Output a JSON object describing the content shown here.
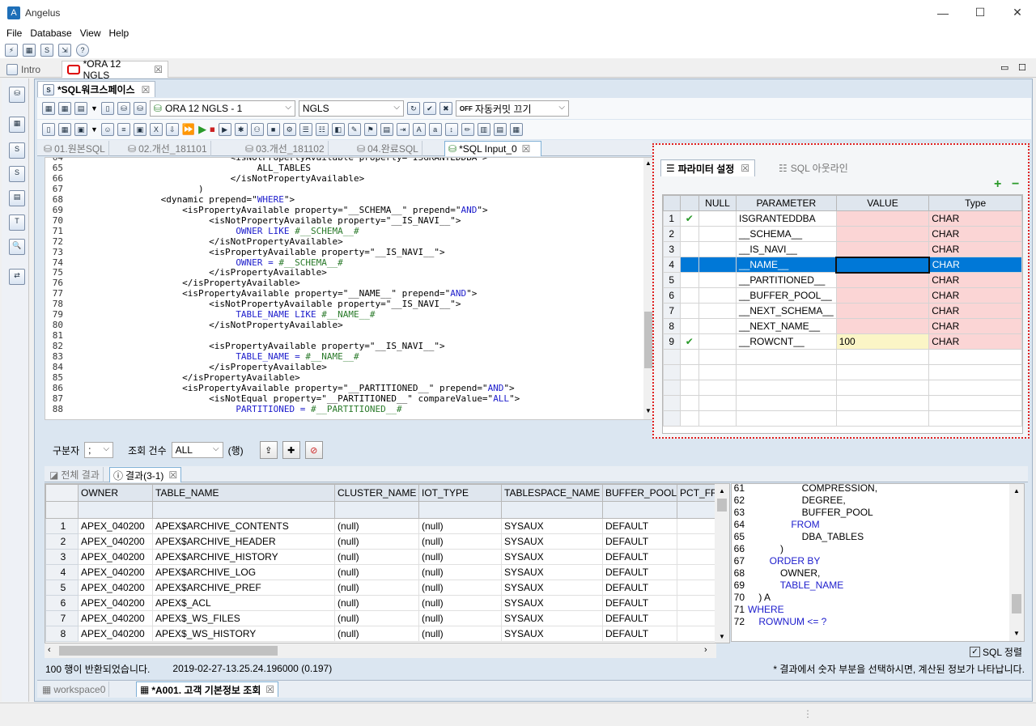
{
  "window": {
    "title": "Angelus",
    "min": "—",
    "max": "☐",
    "close": "✕"
  },
  "menu": [
    "File",
    "Database",
    "View",
    "Help"
  ],
  "top_tabs": [
    {
      "label": "Intro"
    },
    {
      "label": "*ORA 12 NGLS",
      "close": "☒"
    }
  ],
  "workspace_tab": {
    "label": "*SQL워크스페이스",
    "close": "☒"
  },
  "toolbar": {
    "connection": "ORA 12 NGLS - 1",
    "schema": "NGLS",
    "autocommit": "자동커밋 끄기"
  },
  "sql_tabs": [
    "01.원본SQL",
    "02.개선_181101",
    "03.개선_181102",
    "04.완료SQL",
    "*SQL Input_0"
  ],
  "code_lines": [
    {
      "n": "64",
      "t": "                              <isNotPropertyAvailable property=\"ISGRANTEDDBA\">"
    },
    {
      "n": "65",
      "t": "                                   ALL_TABLES"
    },
    {
      "n": "66",
      "t": "                              </isNotPropertyAvailable>"
    },
    {
      "n": "67",
      "t": "                        )"
    },
    {
      "n": "68",
      "t": "                 <dynamic prepend=\"WHERE\">"
    },
    {
      "n": "69",
      "t": "                     <isPropertyAvailable property=\"__SCHEMA__\" prepend=\"AND\">"
    },
    {
      "n": "70",
      "t": "                          <isNotPropertyAvailable property=\"__IS_NAVI__\">"
    },
    {
      "n": "71",
      "t": "                               OWNER LIKE #__SCHEMA__#"
    },
    {
      "n": "72",
      "t": "                          </isNotPropertyAvailable>"
    },
    {
      "n": "73",
      "t": "                          <isPropertyAvailable property=\"__IS_NAVI__\">"
    },
    {
      "n": "74",
      "t": "                               OWNER = #__SCHEMA__#"
    },
    {
      "n": "75",
      "t": "                          </isPropertyAvailable>"
    },
    {
      "n": "76",
      "t": "                     </isPropertyAvailable>"
    },
    {
      "n": "77",
      "t": "                     <isPropertyAvailable property=\"__NAME__\" prepend=\"AND\">"
    },
    {
      "n": "78",
      "t": "                          <isNotPropertyAvailable property=\"__IS_NAVI__\">"
    },
    {
      "n": "79",
      "t": "                               TABLE_NAME LIKE #__NAME__#"
    },
    {
      "n": "80",
      "t": "                          </isNotPropertyAvailable>"
    },
    {
      "n": "81",
      "t": ""
    },
    {
      "n": "82",
      "t": "                          <isPropertyAvailable property=\"__IS_NAVI__\">"
    },
    {
      "n": "83",
      "t": "                               TABLE_NAME = #__NAME__#"
    },
    {
      "n": "84",
      "t": "                          </isPropertyAvailable>"
    },
    {
      "n": "85",
      "t": "                     </isPropertyAvailable>"
    },
    {
      "n": "86",
      "t": "                     <isPropertyAvailable property=\"__PARTITIONED__\" prepend=\"AND\">"
    },
    {
      "n": "87",
      "t": "                          <isNotEqual property=\"__PARTITIONED__\" compareValue=\"ALL\">"
    },
    {
      "n": "88",
      "t": "                               PARTITIONED = #__PARTITIONED__#"
    }
  ],
  "param_panel": {
    "tab1": "파라미터 설정",
    "tab2": "SQL 아웃라인",
    "headers": [
      "NULL",
      "PARAMETER",
      "VALUE",
      "Type"
    ],
    "rows": [
      {
        "n": "1",
        "check": "✔",
        "name": "ISGRANTEDDBA",
        "value": "",
        "type": "CHAR"
      },
      {
        "n": "2",
        "check": "",
        "name": "__SCHEMA__",
        "value": "",
        "type": "CHAR"
      },
      {
        "n": "3",
        "check": "",
        "name": "__IS_NAVI__",
        "value": "",
        "type": "CHAR"
      },
      {
        "n": "4",
        "check": "",
        "name": "__NAME__",
        "value": "",
        "type": "CHAR"
      },
      {
        "n": "5",
        "check": "",
        "name": "__PARTITIONED__",
        "value": "",
        "type": "CHAR"
      },
      {
        "n": "6",
        "check": "",
        "name": "__BUFFER_POOL__",
        "value": "",
        "type": "CHAR"
      },
      {
        "n": "7",
        "check": "",
        "name": "__NEXT_SCHEMA__",
        "value": "",
        "type": "CHAR"
      },
      {
        "n": "8",
        "check": "",
        "name": "__NEXT_NAME__",
        "value": "",
        "type": "CHAR"
      },
      {
        "n": "9",
        "check": "✔",
        "name": "__ROWCNT__",
        "value": "100",
        "type": "CHAR"
      }
    ],
    "selected_row": 4,
    "add": "+",
    "remove": "−"
  },
  "controls": {
    "separator_label": "구분자",
    "separator_value": ";",
    "count_label": "조회 건수",
    "count_value": "ALL",
    "count_unit": "(행)"
  },
  "result_tabs": [
    "전체 결과",
    "결과(3-1)"
  ],
  "result_columns": [
    "OWNER",
    "TABLE_NAME",
    "CLUSTER_NAME",
    "IOT_TYPE",
    "TABLESPACE_NAME",
    "BUFFER_POOL",
    "PCT_FRE"
  ],
  "result_rows": [
    [
      "1",
      "APEX_040200",
      "APEX$ARCHIVE_CONTENTS",
      "(null)",
      "(null)",
      "SYSAUX",
      "DEFAULT"
    ],
    [
      "2",
      "APEX_040200",
      "APEX$ARCHIVE_HEADER",
      "(null)",
      "(null)",
      "SYSAUX",
      "DEFAULT"
    ],
    [
      "3",
      "APEX_040200",
      "APEX$ARCHIVE_HISTORY",
      "(null)",
      "(null)",
      "SYSAUX",
      "DEFAULT"
    ],
    [
      "4",
      "APEX_040200",
      "APEX$ARCHIVE_LOG",
      "(null)",
      "(null)",
      "SYSAUX",
      "DEFAULT"
    ],
    [
      "5",
      "APEX_040200",
      "APEX$ARCHIVE_PREF",
      "(null)",
      "(null)",
      "SYSAUX",
      "DEFAULT"
    ],
    [
      "6",
      "APEX_040200",
      "APEX$_ACL",
      "(null)",
      "(null)",
      "SYSAUX",
      "DEFAULT"
    ],
    [
      "7",
      "APEX_040200",
      "APEX$_WS_FILES",
      "(null)",
      "(null)",
      "SYSAUX",
      "DEFAULT"
    ],
    [
      "8",
      "APEX_040200",
      "APEX$_WS_HISTORY",
      "(null)",
      "(null)",
      "SYSAUX",
      "DEFAULT"
    ]
  ],
  "sql_preview": [
    {
      "n": "61",
      "t": "                    COMPRESSION,",
      "kw": false
    },
    {
      "n": "62",
      "t": "                    DEGREE,",
      "kw": false
    },
    {
      "n": "63",
      "t": "                    BUFFER_POOL",
      "kw": false
    },
    {
      "n": "64",
      "t": "                FROM",
      "kw": true
    },
    {
      "n": "65",
      "t": "                    DBA_TABLES",
      "kw": false
    },
    {
      "n": "66",
      "t": "            )",
      "kw": false
    },
    {
      "n": "67",
      "t": "        ORDER BY",
      "kw": true
    },
    {
      "n": "68",
      "t": "            OWNER,",
      "kw": false
    },
    {
      "n": "69",
      "t": "            TABLE_NAME",
      "kw": true
    },
    {
      "n": "70",
      "t": "    ) A",
      "kw": false
    },
    {
      "n": "71",
      "t": "WHERE",
      "kw": true
    },
    {
      "n": "72",
      "t": "    ROWNUM <= ?",
      "kw": true
    }
  ],
  "sql_align_label": "SQL 정렬",
  "status": {
    "rows": "100 행이 반환되었습니다.",
    "time": "2019-02-27-13.25.24.196000 (0.197)",
    "hint": "* 결과에서 숫자 부분을 선택하시면, 계산된 정보가 나타납니다."
  },
  "bottom_tabs": [
    "workspace0",
    "*A001. 고객 기본정보 조회"
  ],
  "colors": {
    "accent": "#0078d7",
    "pink": "#fbd5d5",
    "yellow": "#fbf5c6",
    "error_border": "#e02020"
  }
}
